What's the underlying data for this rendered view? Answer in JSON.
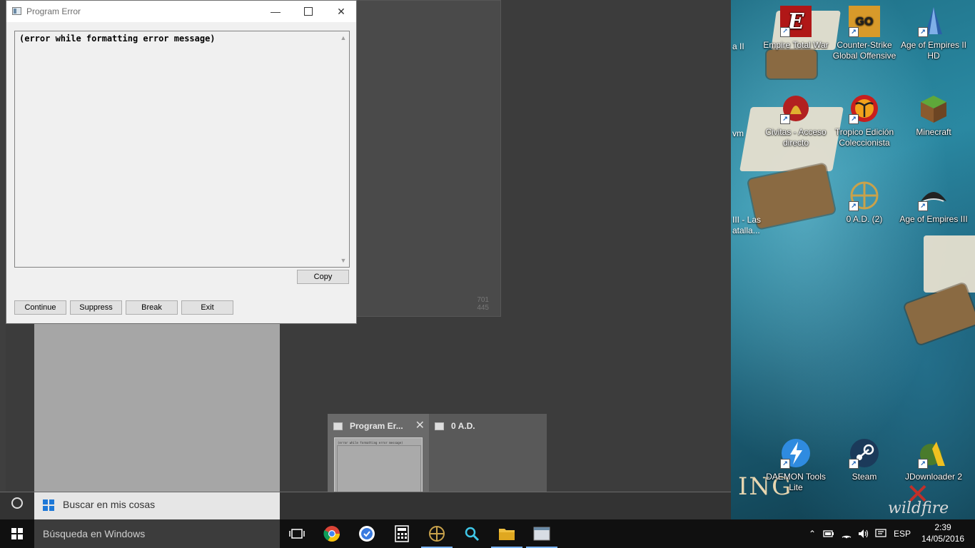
{
  "dialog": {
    "title": "Program Error",
    "message": "(error while formatting error message)",
    "copy_label": "Copy",
    "buttons": {
      "continue": "Continue",
      "suppress": "Suppress",
      "break": "Break",
      "exit": "Exit"
    }
  },
  "background_panel": {
    "coords_line1": "701",
    "coords_line2": "445"
  },
  "task_view": [
    {
      "title": "Program Er..."
    },
    {
      "title": "0 A.D."
    }
  ],
  "cortana": {
    "my_stuff_label": "Buscar en mis cosas"
  },
  "taskbar": {
    "search_placeholder": "Búsqueda en Windows",
    "language": "ESP",
    "time": "2:39",
    "date": "14/05/2016",
    "pinned_icons": [
      "task-view-icon",
      "chrome-icon",
      "browser-icon",
      "calculator-icon",
      "0ad-icon",
      "search-tool-icon",
      "file-explorer-icon",
      "program-icon"
    ]
  },
  "desktop": {
    "icons": [
      {
        "label_line1": "Empire Total War",
        "label_line2": "",
        "icon": "empire-total-war-icon"
      },
      {
        "label_line1": "Counter-Strike",
        "label_line2": "Global Offensive",
        "icon": "csgo-icon"
      },
      {
        "label_line1": "Age of Empires II",
        "label_line2": "HD",
        "icon": "aoe2-icon"
      },
      {
        "label_line1": "Civitas - Acceso",
        "label_line2": "directo",
        "icon": "civitas-icon"
      },
      {
        "label_line1": "Tropico Edición",
        "label_line2": "Coleccionista",
        "icon": "tropico-icon"
      },
      {
        "label_line1": "Minecraft",
        "label_line2": "",
        "icon": "minecraft-icon"
      },
      {
        "label_line1": "0 A.D. (2)",
        "label_line2": "",
        "icon": "0ad-icon"
      },
      {
        "label_line1": "Age of Empires III",
        "label_line2": "",
        "icon": "aoe3-icon"
      },
      {
        "label_line1": "DAEMON Tools",
        "label_line2": "Lite",
        "icon": "daemon-tools-icon"
      },
      {
        "label_line1": "Steam",
        "label_line2": "",
        "icon": "steam-icon"
      },
      {
        "label_line1": "JDownloader 2",
        "label_line2": "",
        "icon": "jdownloader-icon"
      }
    ],
    "partial_labels": [
      "a II",
      "vm",
      "III - Las",
      "atalla..."
    ],
    "wallpaper_text": "ING",
    "wallpaper_brand": "wildfire"
  }
}
